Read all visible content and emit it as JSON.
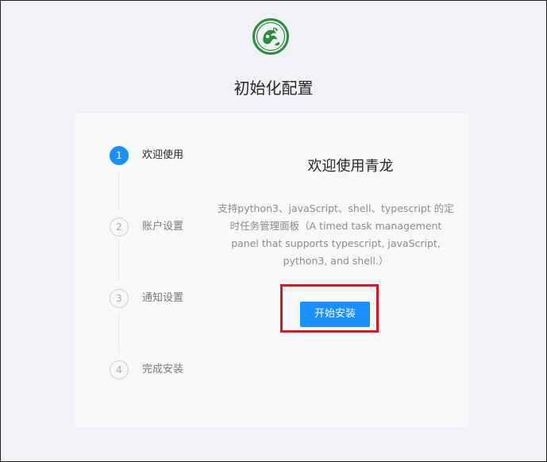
{
  "page": {
    "title": "初始化配置"
  },
  "steps": [
    {
      "number": "1",
      "label": "欢迎使用",
      "active": true
    },
    {
      "number": "2",
      "label": "账户设置",
      "active": false
    },
    {
      "number": "3",
      "label": "通知设置",
      "active": false
    },
    {
      "number": "4",
      "label": "完成安装",
      "active": false
    }
  ],
  "welcome": {
    "title": "欢迎使用青龙",
    "description": "支持python3、javaScript、shell、typescript 的定时任务管理面板（A timed task management panel that supports typescript, javaScript, python3, and shell.）",
    "install_button": "开始安装"
  },
  "colors": {
    "accent": "#1890ff",
    "highlight": "#e0141e",
    "logo": "#2e8b3e"
  },
  "icons": {
    "logo": "qinglong-dragon-logo-icon"
  }
}
